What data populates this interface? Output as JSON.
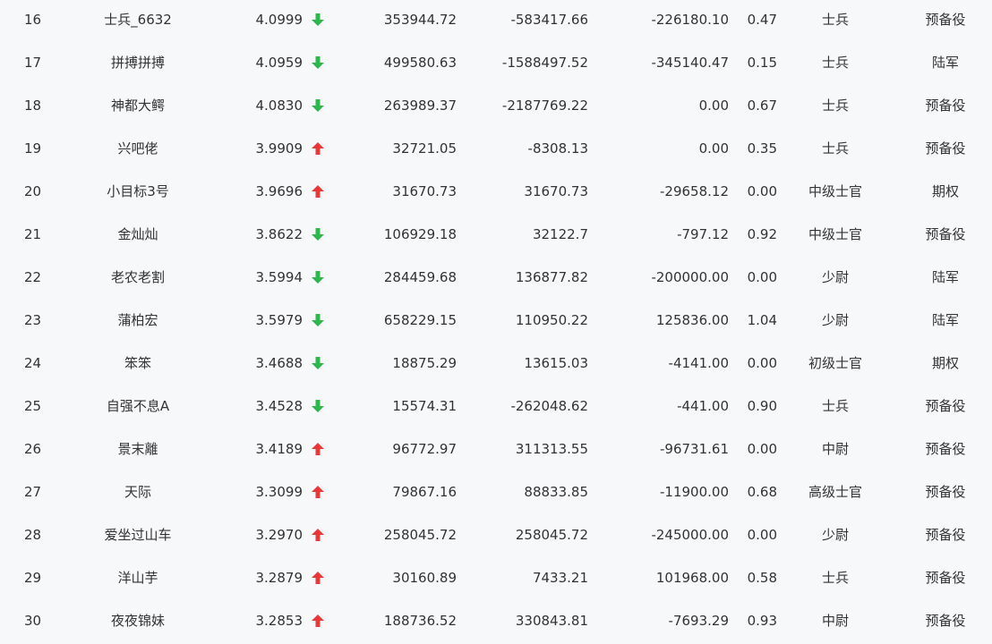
{
  "colors": {
    "up": "#e8393a",
    "down": "#2db84b",
    "background": "#f6f8fa",
    "text": "#333333"
  },
  "rows": [
    {
      "rank": "16",
      "name": "士兵_6632",
      "score": "4.0999",
      "trend": "down",
      "v1": "353944.72",
      "v2": "-583417.66",
      "v3": "-226180.10",
      "ratio": "0.47",
      "level": "士兵",
      "type": "预备役"
    },
    {
      "rank": "17",
      "name": "拼搏拼搏",
      "score": "4.0959",
      "trend": "down",
      "v1": "499580.63",
      "v2": "-1588497.52",
      "v3": "-345140.47",
      "ratio": "0.15",
      "level": "士兵",
      "type": "陆军"
    },
    {
      "rank": "18",
      "name": "神都大鳄",
      "score": "4.0830",
      "trend": "down",
      "v1": "263989.37",
      "v2": "-2187769.22",
      "v3": "0.00",
      "ratio": "0.67",
      "level": "士兵",
      "type": "预备役"
    },
    {
      "rank": "19",
      "name": "兴吧佬",
      "score": "3.9909",
      "trend": "up",
      "v1": "32721.05",
      "v2": "-8308.13",
      "v3": "0.00",
      "ratio": "0.35",
      "level": "士兵",
      "type": "预备役"
    },
    {
      "rank": "20",
      "name": "小目标3号",
      "score": "3.9696",
      "trend": "up",
      "v1": "31670.73",
      "v2": "31670.73",
      "v3": "-29658.12",
      "ratio": "0.00",
      "level": "中级士官",
      "type": "期权"
    },
    {
      "rank": "21",
      "name": "金灿灿",
      "score": "3.8622",
      "trend": "down",
      "v1": "106929.18",
      "v2": "32122.7",
      "v3": "-797.12",
      "ratio": "0.92",
      "level": "中级士官",
      "type": "预备役"
    },
    {
      "rank": "22",
      "name": "老农老割",
      "score": "3.5994",
      "trend": "down",
      "v1": "284459.68",
      "v2": "136877.82",
      "v3": "-200000.00",
      "ratio": "0.00",
      "level": "少尉",
      "type": "陆军"
    },
    {
      "rank": "23",
      "name": "蒲柏宏",
      "score": "3.5979",
      "trend": "down",
      "v1": "658229.15",
      "v2": "110950.22",
      "v3": "125836.00",
      "ratio": "1.04",
      "level": "少尉",
      "type": "陆军"
    },
    {
      "rank": "24",
      "name": "笨笨",
      "score": "3.4688",
      "trend": "down",
      "v1": "18875.29",
      "v2": "13615.03",
      "v3": "-4141.00",
      "ratio": "0.00",
      "level": "初级士官",
      "type": "期权"
    },
    {
      "rank": "25",
      "name": "自强不息A",
      "score": "3.4528",
      "trend": "down",
      "v1": "15574.31",
      "v2": "-262048.62",
      "v3": "-441.00",
      "ratio": "0.90",
      "level": "士兵",
      "type": "预备役"
    },
    {
      "rank": "26",
      "name": "景末離",
      "score": "3.4189",
      "trend": "up",
      "v1": "96772.97",
      "v2": "311313.55",
      "v3": "-96731.61",
      "ratio": "0.00",
      "level": "中尉",
      "type": "预备役"
    },
    {
      "rank": "27",
      "name": "天际",
      "score": "3.3099",
      "trend": "up",
      "v1": "79867.16",
      "v2": "88833.85",
      "v3": "-11900.00",
      "ratio": "0.68",
      "level": "高级士官",
      "type": "预备役"
    },
    {
      "rank": "28",
      "name": "爱坐过山车",
      "score": "3.2970",
      "trend": "up",
      "v1": "258045.72",
      "v2": "258045.72",
      "v3": "-245000.00",
      "ratio": "0.00",
      "level": "少尉",
      "type": "预备役"
    },
    {
      "rank": "29",
      "name": "洋山芋",
      "score": "3.2879",
      "trend": "up",
      "v1": "30160.89",
      "v2": "7433.21",
      "v3": "101968.00",
      "ratio": "0.58",
      "level": "士兵",
      "type": "预备役"
    },
    {
      "rank": "30",
      "name": "夜夜锦妹",
      "score": "3.2853",
      "trend": "up",
      "v1": "188736.52",
      "v2": "330843.81",
      "v3": "-7693.29",
      "ratio": "0.93",
      "level": "中尉",
      "type": "预备役"
    }
  ]
}
